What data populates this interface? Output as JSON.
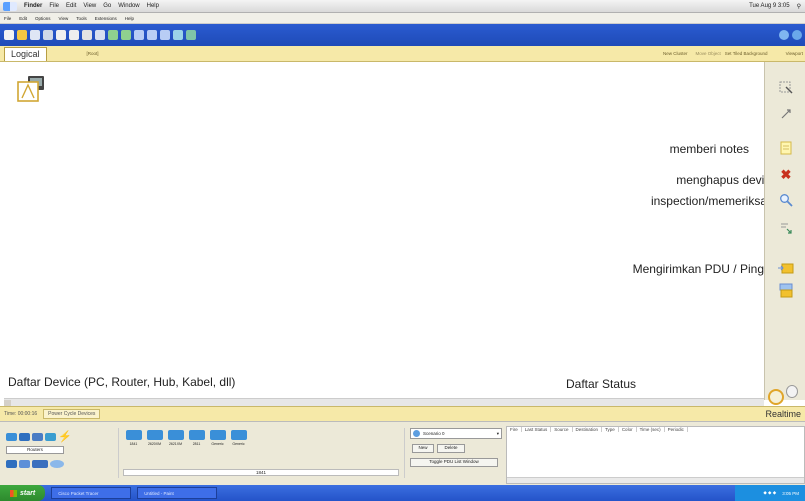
{
  "mac_menu": {
    "app_name": "Finder",
    "items": [
      "File",
      "Edit",
      "View",
      "Go",
      "Window",
      "Help"
    ],
    "clock": "Tue Aug 9 3:05"
  },
  "app_menu": {
    "items": [
      "File",
      "Edit",
      "Options",
      "View",
      "Tools",
      "Extensions",
      "Help"
    ]
  },
  "workspace": {
    "tab_label": "Logical",
    "root_label": "[Root]",
    "new_cluster": "New Cluster",
    "move_object": "Move Object",
    "set_tiled": "Set Tiled Background",
    "viewport": "Viewport"
  },
  "annotations": {
    "notes": "memberi notes",
    "delete": "menghapus device",
    "inspect": "inspection/memeriksa",
    "pdu": "Mengirimkan PDU / Ping",
    "device_list": "Daftar Device (PC, Router, Hub, Kabel, dll)",
    "status_list": "Daftar Status"
  },
  "timebar": {
    "time": "Time: 00:00:16",
    "power_cycle": "Power Cycle Devices",
    "mode": "Realtime"
  },
  "devices": {
    "category_label": "Routers",
    "models": [
      "1841",
      "2620XM",
      "2621XM",
      "2811",
      "Generic",
      "Generic"
    ],
    "selected_model": "1841"
  },
  "scenario": {
    "selected": "Scenario 0",
    "new_label": "New",
    "delete_label": "Delete",
    "toggle_label": "Toggle PDU List Window"
  },
  "pdu_table": {
    "columns": [
      "Fire",
      "Last Status",
      "Source",
      "Destination",
      "Type",
      "Color",
      "Time (sec)",
      "Periodic"
    ]
  },
  "taskbar": {
    "start_label": "start",
    "tasks": [
      "Cisco Packet Tracer",
      "Untitled - Paint"
    ],
    "tray_time": "3:05 PM"
  },
  "colors": {
    "toolbar_blue": "#2453c9",
    "workspace_bar": "#f6e9a8",
    "delete_red": "#c8321e",
    "start_green": "#3ea83e"
  }
}
